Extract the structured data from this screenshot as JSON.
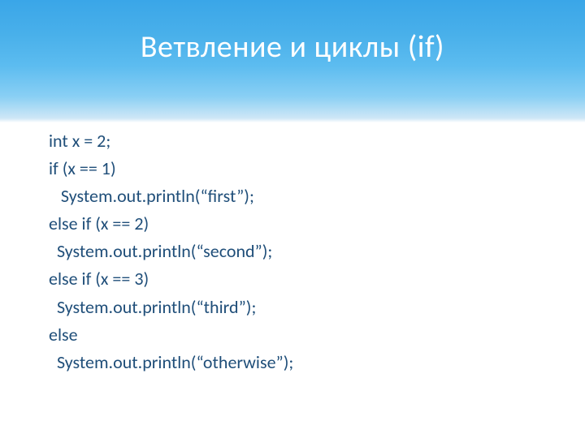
{
  "title": "Ветвление и циклы (if)",
  "code": {
    "l0": "int x = 2;",
    "l1": "",
    "l2": "if (x == 1)",
    "l3": "   System.out.println(“first”);",
    "l4": "else if (x == 2)",
    "l5": "  System.out.println(“second”);",
    "l6": "else if (x == 3)",
    "l7": "  System.out.println(“third”);",
    "l8": "else",
    "l9": "  System.out.println(“otherwise”);"
  }
}
